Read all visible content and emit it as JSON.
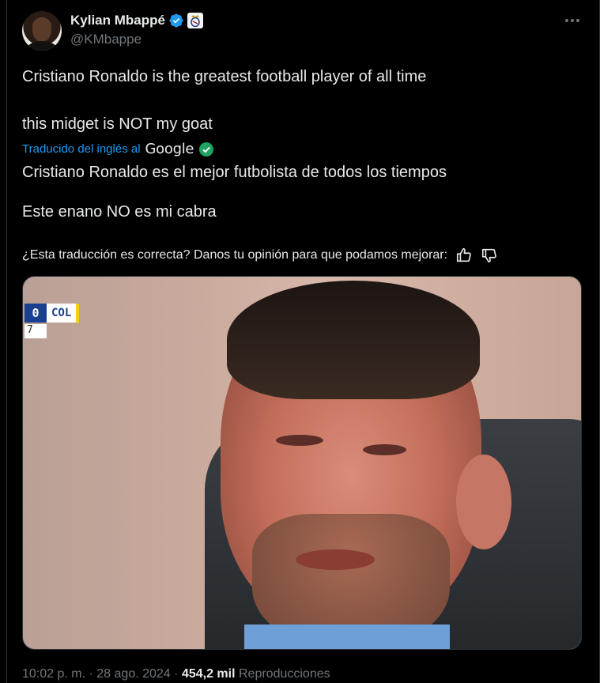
{
  "tweet": {
    "author_name": "Kylian Mbappé",
    "author_handle": "@KMbappe",
    "original_lines": [
      "Cristiano Ronaldo is the greatest football player of all time",
      "this midget is NOT my goat"
    ],
    "translation_label": "Traducido del inglés al",
    "translation_provider": "Google",
    "translated_lines": [
      "Cristiano Ronaldo es el mejor futbolista de todos los tiempos",
      "Este enano NO es mi cabra"
    ],
    "feedback_prompt": "¿Esta traducción es correcta? Danos tu opinión para que podamos mejorar:",
    "media": {
      "score_value": "0",
      "score_team": "COL",
      "score_minute": "7"
    },
    "time": "10:02 p. m.",
    "date": "28 ago. 2024",
    "views_count": "454,2 mil",
    "views_label": "Reproducciones",
    "separator": "·"
  },
  "colors": {
    "background": "#000000",
    "text": "#e7e9ea",
    "secondary": "#71767b",
    "link": "#1d9bf0",
    "verified": "#1d9bf0"
  },
  "icons": [
    "verified-badge-icon",
    "real-madrid-crest-icon",
    "more-options-icon",
    "google-verified-check-icon",
    "thumbs-up-icon",
    "thumbs-down-icon"
  ]
}
